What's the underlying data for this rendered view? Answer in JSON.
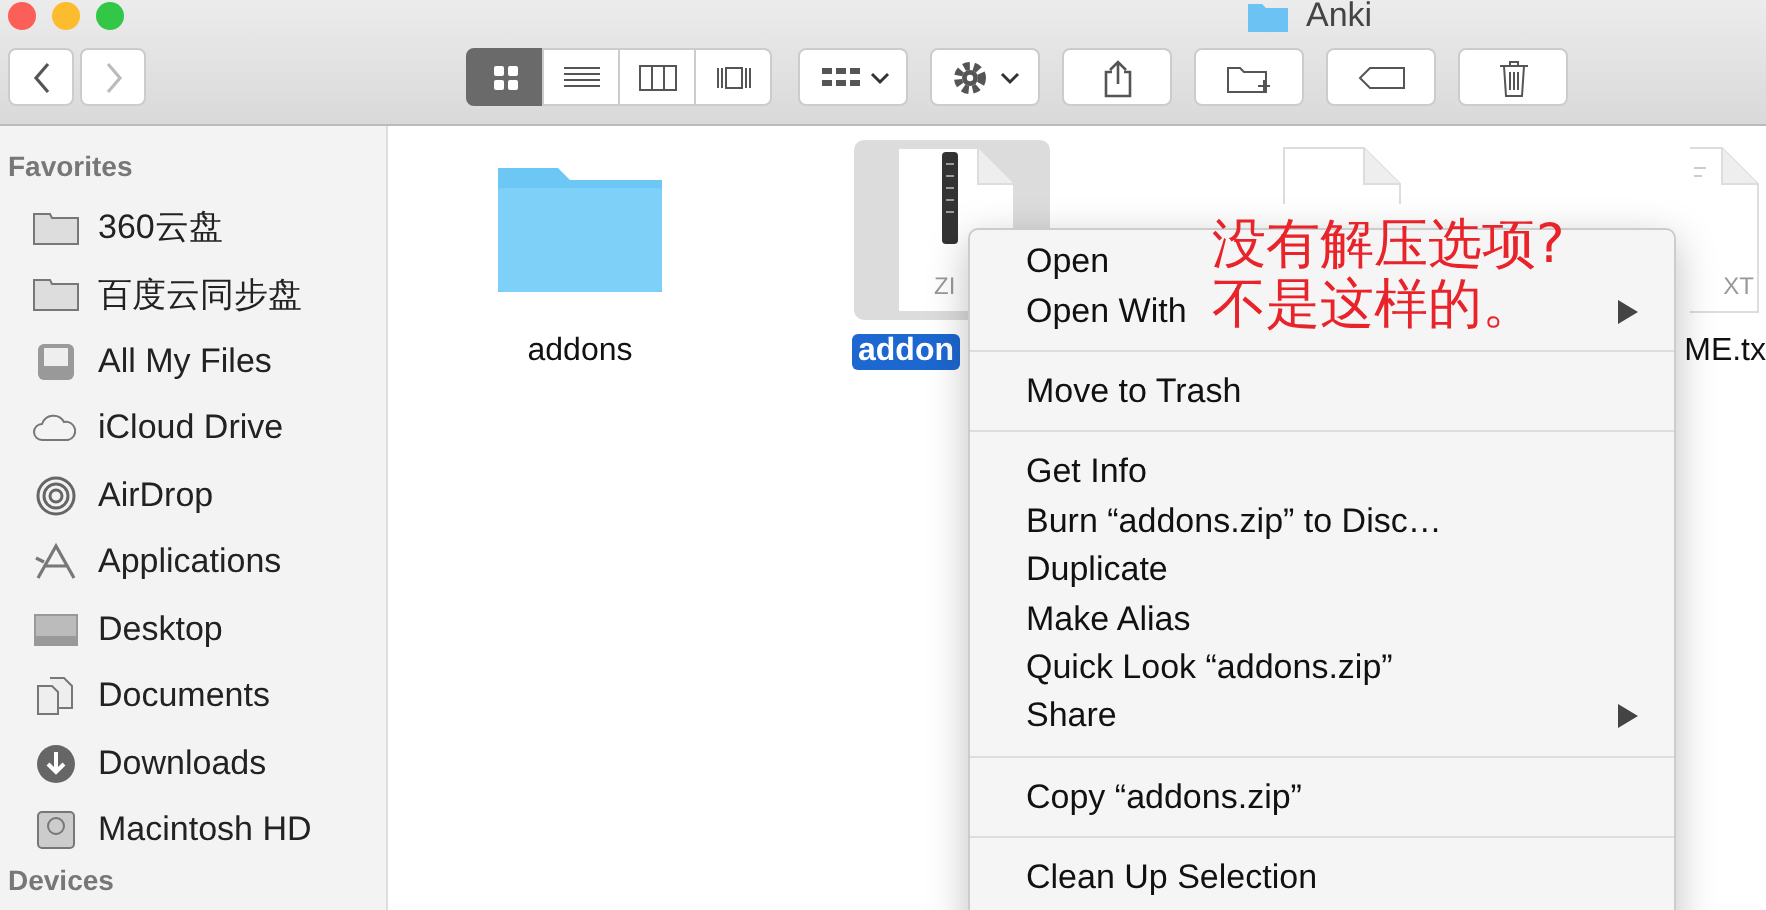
{
  "window": {
    "title": "Anki"
  },
  "toolbar": {
    "view_modes": [
      {
        "selected": true
      },
      {
        "selected": false
      },
      {
        "selected": false
      },
      {
        "selected": false
      }
    ]
  },
  "sidebar": {
    "section": "Favorites",
    "items": [
      {
        "label": "360云盘"
      },
      {
        "label": "百度云同步盘"
      },
      {
        "label": "All My Files"
      },
      {
        "label": "iCloud Drive"
      },
      {
        "label": "AirDrop"
      },
      {
        "label": "Applications"
      },
      {
        "label": "Desktop"
      },
      {
        "label": "Documents"
      },
      {
        "label": "Downloads"
      },
      {
        "label": "Macintosh HD"
      }
    ],
    "next_section": "Devices"
  },
  "files": [
    {
      "kind": "folder",
      "name": "addons",
      "selected": false
    },
    {
      "kind": "zip",
      "name": "addon",
      "icon_text": "ZI",
      "selected": true
    },
    {
      "kind": "blank",
      "selected": false
    },
    {
      "kind": "text",
      "name": "ME.tx",
      "icon_text": "XT",
      "selected": false
    }
  ],
  "context_menu": {
    "groups": [
      [
        {
          "label": "Open",
          "submenu": false
        },
        {
          "label": "Open With",
          "submenu": true
        }
      ],
      [
        {
          "label": "Move to Trash",
          "submenu": false
        }
      ],
      [
        {
          "label": "Get Info",
          "submenu": false
        },
        {
          "label": "Burn “addons.zip” to Disc…",
          "submenu": false
        },
        {
          "label": "Duplicate",
          "submenu": false
        },
        {
          "label": "Make Alias",
          "submenu": false
        },
        {
          "label": "Quick Look “addons.zip”",
          "submenu": false
        },
        {
          "label": "Share",
          "submenu": true
        }
      ],
      [
        {
          "label": "Copy “addons.zip”",
          "submenu": false
        }
      ],
      [
        {
          "label": "Clean Up Selection",
          "submenu": false
        }
      ]
    ]
  },
  "annotation": [
    "没有解压选项?",
    "不是这样的。"
  ]
}
